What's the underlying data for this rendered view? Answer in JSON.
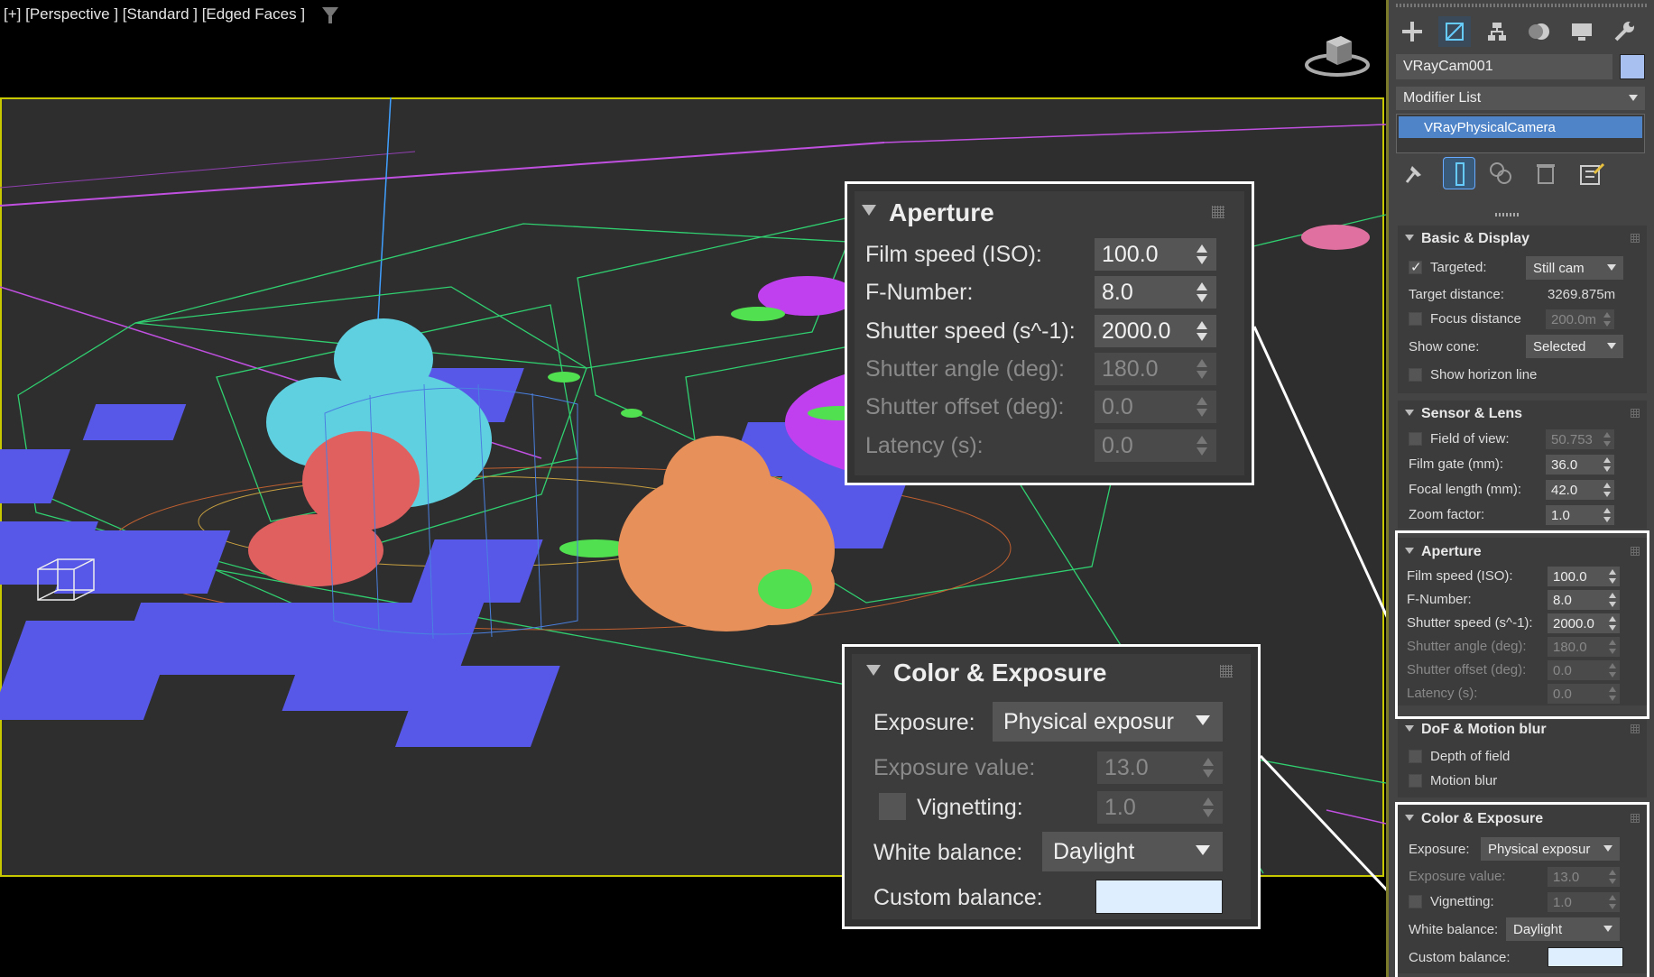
{
  "viewport": {
    "label": "[+] [Perspective ] [Standard ] [Edged Faces ]",
    "colors": {
      "frame": "#c8c800",
      "cyan": "#5fd0e0",
      "red": "#e06060",
      "orange": "#e8905a",
      "green": "#50e050",
      "purple": "#c040f0",
      "blue": "#5050e0",
      "pink": "#e070a0"
    }
  },
  "toolbar": {
    "icons": [
      "create-icon",
      "modify-icon",
      "hierarchy-icon",
      "motion-icon",
      "display-icon",
      "utilities-icon"
    ]
  },
  "object": {
    "name": "VRayCam001",
    "color": "#a8c0f0"
  },
  "modifier_list": {
    "label": "Modifier List"
  },
  "stack": {
    "selected": "VRayPhysicalCamera"
  },
  "basic_display": {
    "title": "Basic & Display",
    "targeted_label": "Targeted:",
    "targeted_checked": true,
    "type_value": "Still cam",
    "target_distance_label": "Target distance:",
    "target_distance_value": "3269.875m",
    "focus_distance_label": "Focus distance",
    "focus_distance_value": "200.0m",
    "show_cone_label": "Show cone:",
    "show_cone_value": "Selected",
    "show_horizon_label": "Show horizon line"
  },
  "sensor_lens": {
    "title": "Sensor & Lens",
    "fov_label": "Field of view:",
    "fov_value": "50.753",
    "film_gate_label": "Film gate (mm):",
    "film_gate_value": "36.0",
    "focal_length_label": "Focal length (mm):",
    "focal_length_value": "42.0",
    "zoom_factor_label": "Zoom factor:",
    "zoom_factor_value": "1.0"
  },
  "aperture": {
    "title": "Aperture",
    "film_speed_label": "Film speed (ISO):",
    "film_speed_value": "100.0",
    "f_number_label": "F-Number:",
    "f_number_value": "8.0",
    "shutter_speed_label": "Shutter speed (s^-1):",
    "shutter_speed_value": "2000.0",
    "shutter_angle_label": "Shutter angle (deg):",
    "shutter_angle_value": "180.0",
    "shutter_offset_label": "Shutter offset (deg):",
    "shutter_offset_value": "0.0",
    "latency_label": "Latency (s):",
    "latency_value": "0.0"
  },
  "dof_motion": {
    "title": "DoF & Motion blur",
    "dof_label": "Depth of field",
    "motion_blur_label": "Motion blur"
  },
  "color_exposure": {
    "title": "Color & Exposure",
    "exposure_label": "Exposure:",
    "exposure_value": "Physical exposur",
    "exposure_value_label": "Exposure value:",
    "exposure_value_value": "13.0",
    "vignetting_label": "Vignetting:",
    "vignetting_value": "1.0",
    "white_balance_label": "White balance:",
    "white_balance_value": "Daylight",
    "custom_balance_label": "Custom balance:",
    "custom_balance_color": "#dfeeff"
  }
}
